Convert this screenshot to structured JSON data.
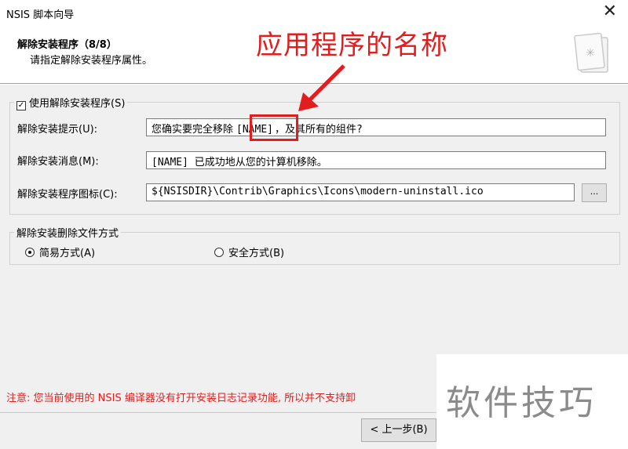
{
  "window": {
    "title": "NSIS 脚本向导",
    "close_glyph": "✕"
  },
  "header": {
    "title": "解除安装程序（8/8）",
    "subtitle": "请指定解除安装程序属性。"
  },
  "annotation": {
    "label": "应用程序的名称"
  },
  "uninstall_group": {
    "checkbox_label": "使用解除安装程序(S)",
    "checked": true,
    "prompt_label": "解除安装提示(U):",
    "prompt_before": "您确实要完全移除",
    "prompt_token": "[NAME]",
    "prompt_after": "，及其所有的组件?",
    "message_label": "解除安装消息(M):",
    "message_value": "[NAME] 已成功地从您的计算机移除。",
    "icon_label": "解除安装程序图标(C):",
    "icon_value": "${NSISDIR}\\Contrib\\Graphics\\Icons\\modern-uninstall.ico",
    "browse_label": "..."
  },
  "delete_group": {
    "legend": "解除安装删除文件方式",
    "options": [
      {
        "label": "简易方式(A)",
        "selected": true
      },
      {
        "label": "安全方式(B)",
        "selected": false
      }
    ]
  },
  "footer": {
    "note": "注意: 您当前使用的 NSIS 编译器没有打开安装日志记录功能, 所以并不支持卸",
    "back_button": "< 上一步(B)"
  },
  "watermark": {
    "text": "软件技巧"
  },
  "colors": {
    "annotation_red": "#e21d1d",
    "window_bg": "#f0f0f0"
  }
}
